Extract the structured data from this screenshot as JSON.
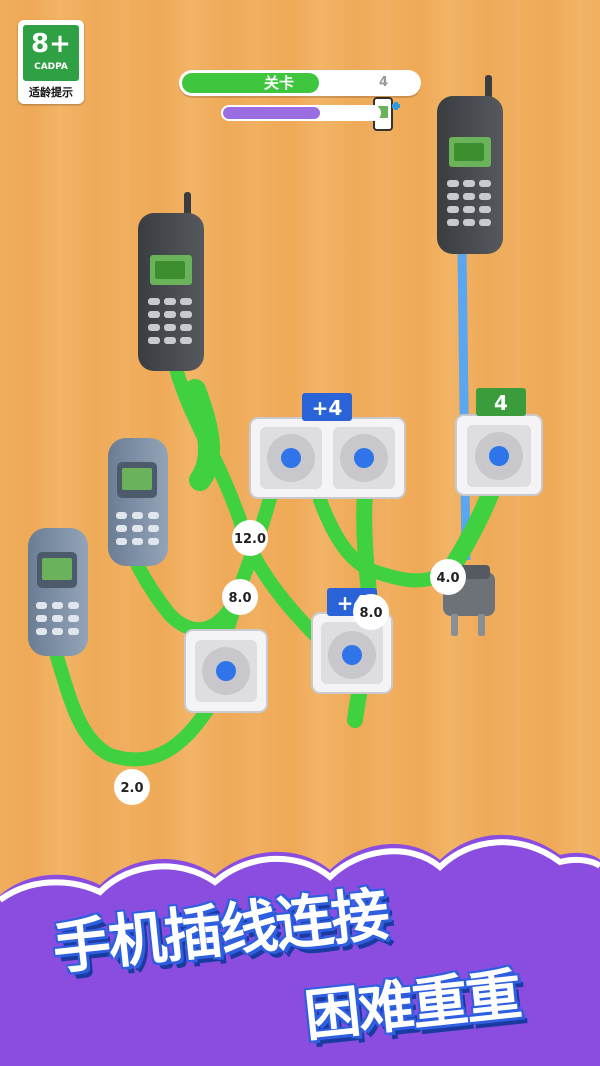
{
  "age_badge": {
    "rating": "8+",
    "org": "CADPA",
    "tip": "适龄提示"
  },
  "hud": {
    "level_label": "关卡",
    "level_number": "4",
    "level_progress": 0.58,
    "charge_progress": 0.62
  },
  "sockets": [
    {
      "badge": "+4",
      "badge_color": "#2a63d8"
    },
    {
      "badge": "4",
      "badge_color": "#3a9c3a"
    },
    {
      "badge": "+4",
      "badge_color": "#2a63d8"
    }
  ],
  "cable_labels": [
    "12.0",
    "8.0",
    "4.0",
    "8.0",
    "2.0"
  ],
  "banner": {
    "line1": "手机插线连接",
    "line2": "困难重重"
  },
  "colors": {
    "cable": "#3fd13f",
    "socket_ring": "#2f74e8",
    "banner": "#8a4de0",
    "blue_cable": "#5aa6f0"
  }
}
